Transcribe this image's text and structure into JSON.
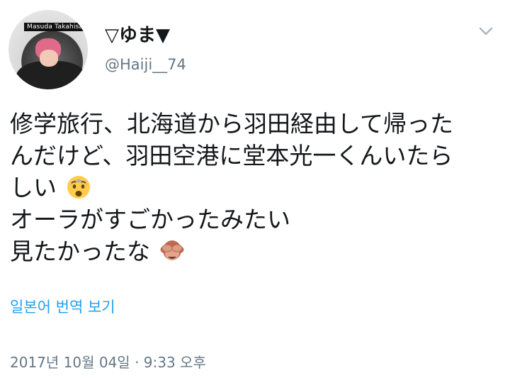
{
  "author": {
    "display_name": "▽ゆま▼",
    "handle": "@Haiji__74",
    "avatar_tag": "Masuda Takahisa"
  },
  "tweet": {
    "lines": [
      "修学旅行、北海道から羽田経由して帰った",
      "んだけど、羽田空港に堂本光一くんいたら",
      "しい",
      "オーラがすごかったみたい",
      "見たかったな"
    ],
    "emojis": [
      "fearful-face-icon",
      "see-no-evil-monkey-icon"
    ]
  },
  "translate_label": "일본어 번역 보기",
  "timestamp": "2017년 10월 04일 · 9:33 오후",
  "icons": {
    "menu": "chevron-down-icon"
  },
  "colors": {
    "link": "#1da1f2",
    "secondary_text": "#657786",
    "primary_text": "#14171a"
  }
}
